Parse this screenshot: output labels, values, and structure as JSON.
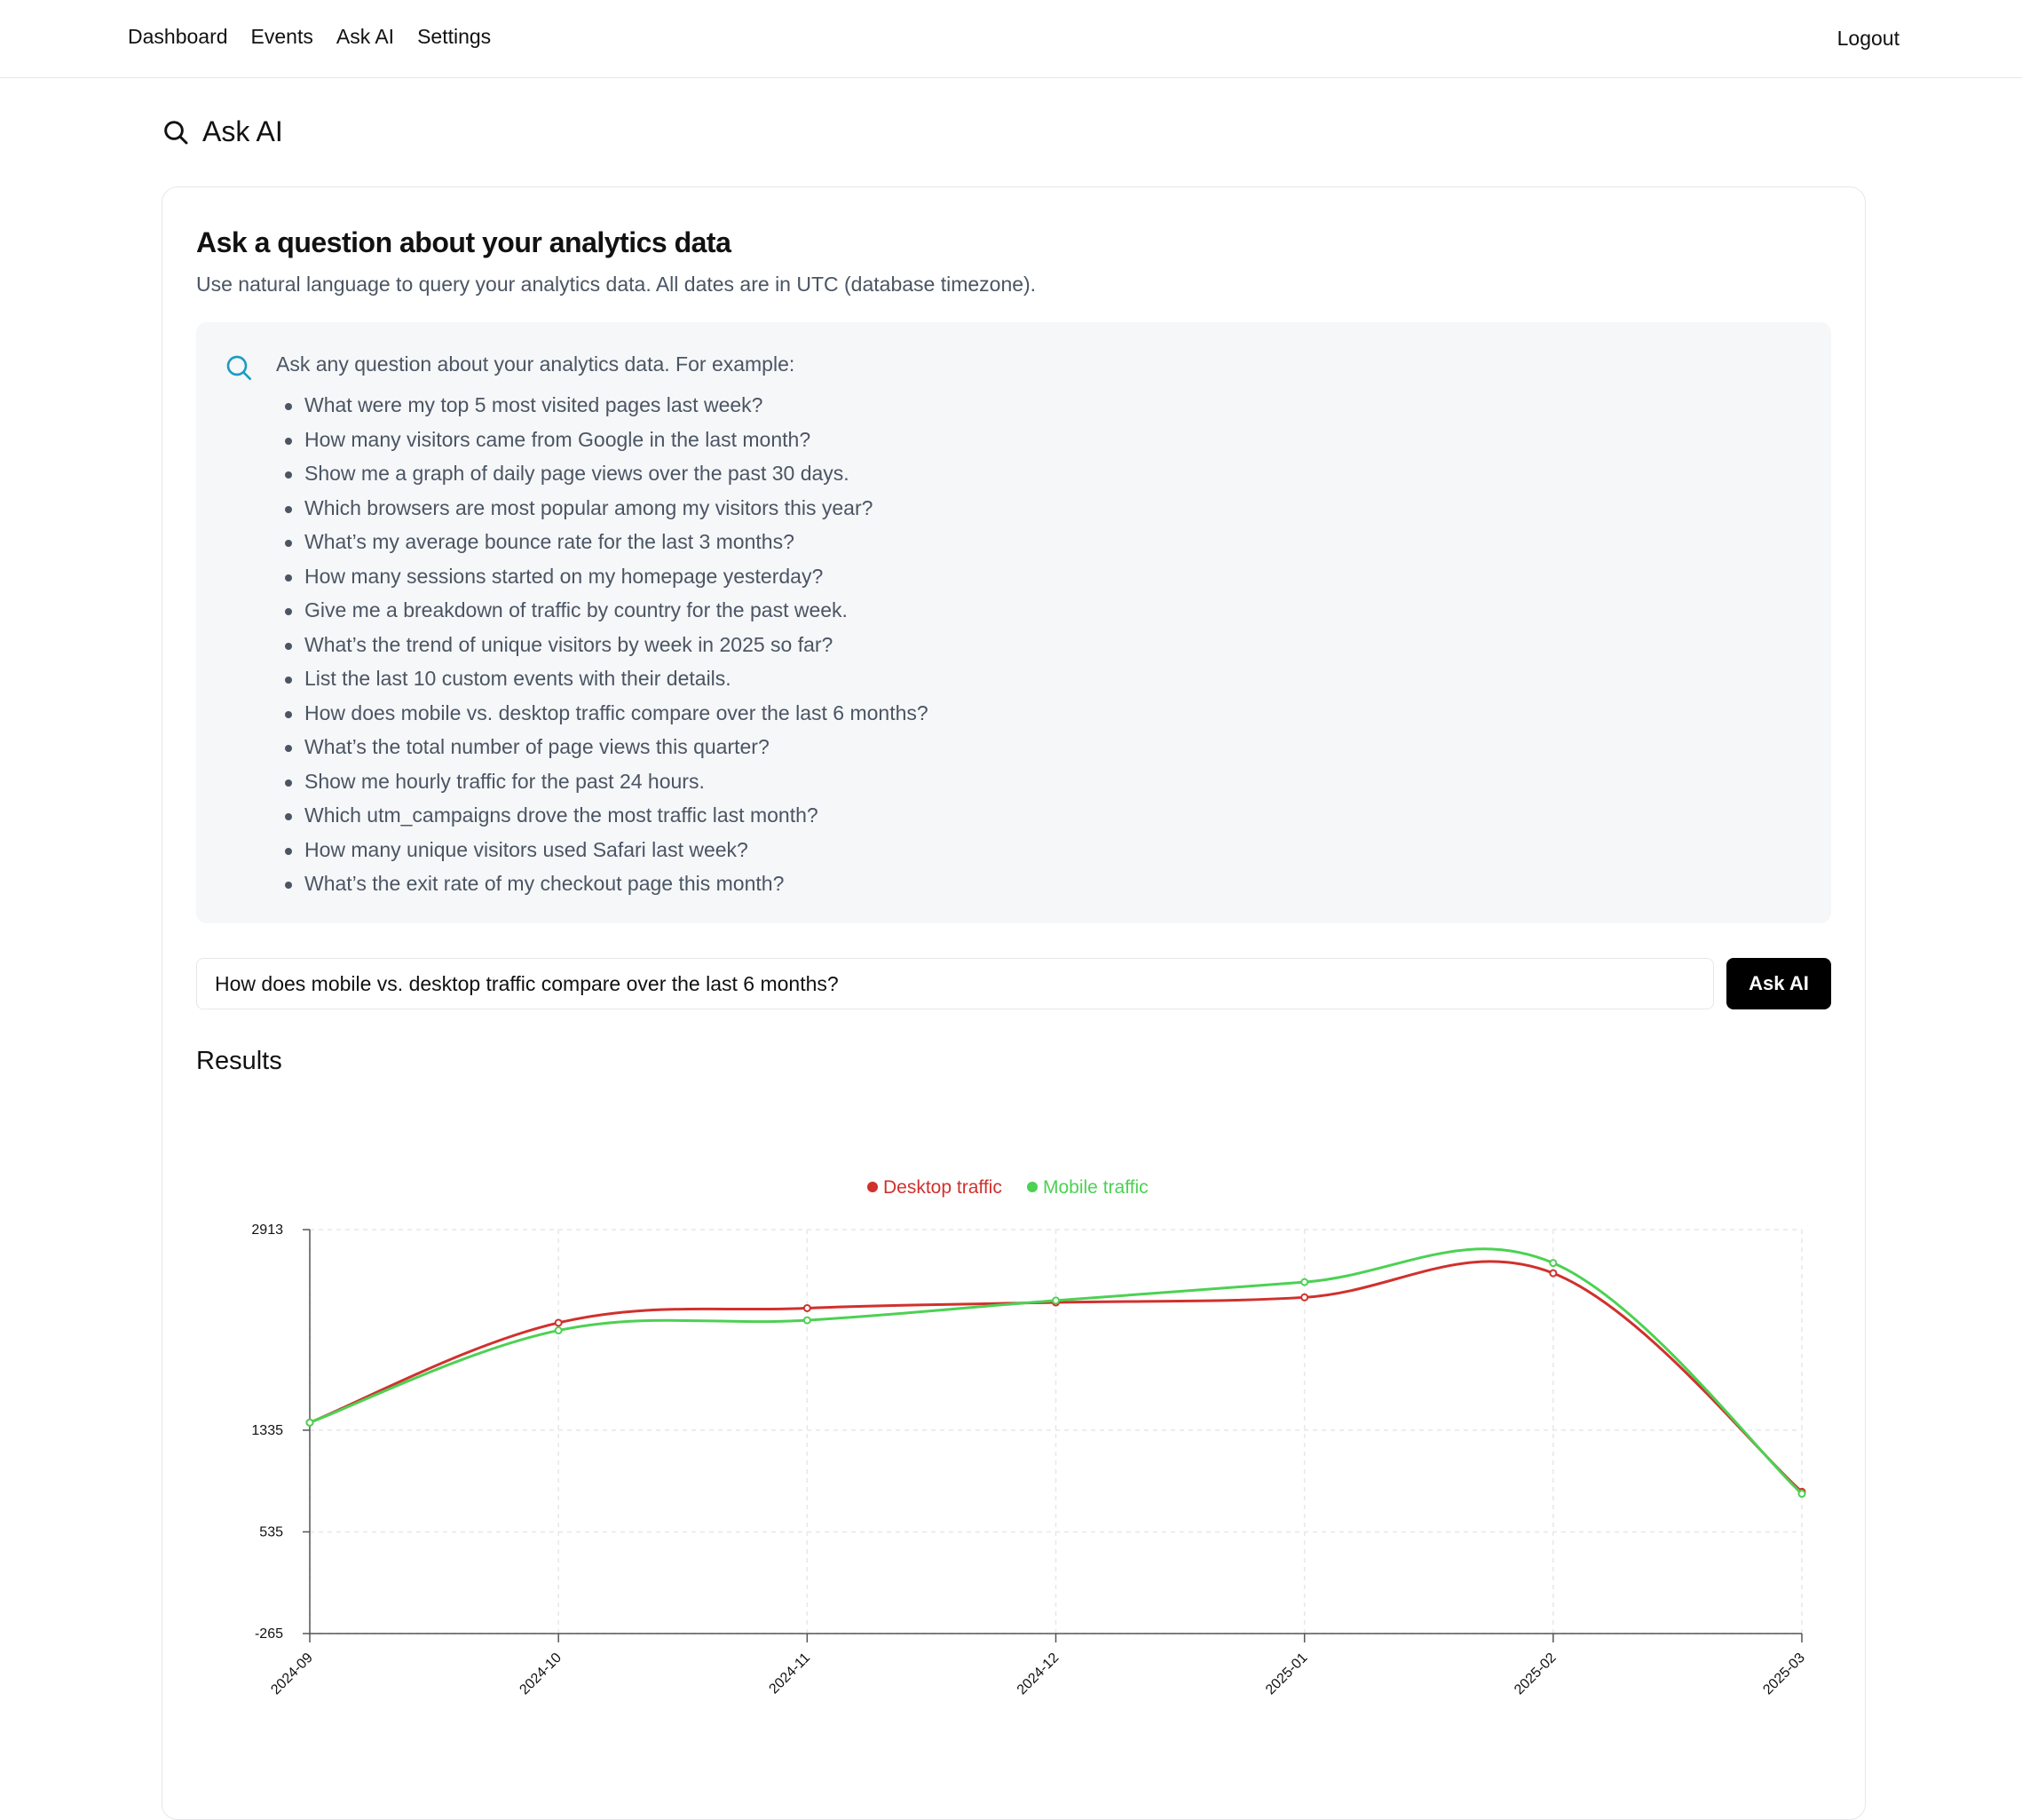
{
  "nav": {
    "links": [
      "Dashboard",
      "Events",
      "Ask AI",
      "Settings"
    ],
    "logout": "Logout"
  },
  "page": {
    "title": "Ask AI",
    "icon": "search-icon"
  },
  "card": {
    "title": "Ask a question about your analytics data",
    "subtitle": "Use natural language to query your analytics data. All dates are in UTC (database timezone)."
  },
  "info": {
    "icon": "search-icon",
    "lead": "Ask any question about your analytics data. For example:",
    "examples": [
      "What were my top 5 most visited pages last week?",
      "How many visitors came from Google in the last month?",
      "Show me a graph of daily page views over the past 30 days.",
      "Which browsers are most popular among my visitors this year?",
      "What’s my average bounce rate for the last 3 months?",
      "How many sessions started on my homepage yesterday?",
      "Give me a breakdown of traffic by country for the past week.",
      "What’s the trend of unique visitors by week in 2025 so far?",
      "List the last 10 custom events with their details.",
      "How does mobile vs. desktop traffic compare over the last 6 months?",
      "What’s the total number of page views this quarter?",
      "Show me hourly traffic for the past 24 hours.",
      "Which utm_campaigns drove the most traffic last month?",
      "How many unique visitors used Safari last week?",
      "What’s the exit rate of my checkout page this month?"
    ]
  },
  "query": {
    "value": "How does mobile vs. desktop traffic compare over the last 6 months?",
    "button": "Ask AI"
  },
  "results": {
    "title": "Results"
  },
  "colors": {
    "desktop": "#d0312d",
    "mobile": "#4cd153",
    "accent": "#1e9bc3"
  },
  "chart_data": {
    "type": "line",
    "categories": [
      "2024-09",
      "2024-10",
      "2024-11",
      "2024-12",
      "2025-01",
      "2025-02",
      "2025-03"
    ],
    "series": [
      {
        "name": "Desktop traffic",
        "color": "#d0312d",
        "values": [
          1395,
          2180,
          2295,
          2340,
          2380,
          2570,
          850
        ]
      },
      {
        "name": "Mobile traffic",
        "color": "#4cd153",
        "values": [
          1395,
          2120,
          2200,
          2355,
          2500,
          2650,
          835
        ]
      }
    ],
    "yticks": [
      2913,
      1335,
      535,
      -265
    ],
    "ylim": [
      -265,
      2913
    ],
    "legend": "top-center",
    "grid": true
  }
}
